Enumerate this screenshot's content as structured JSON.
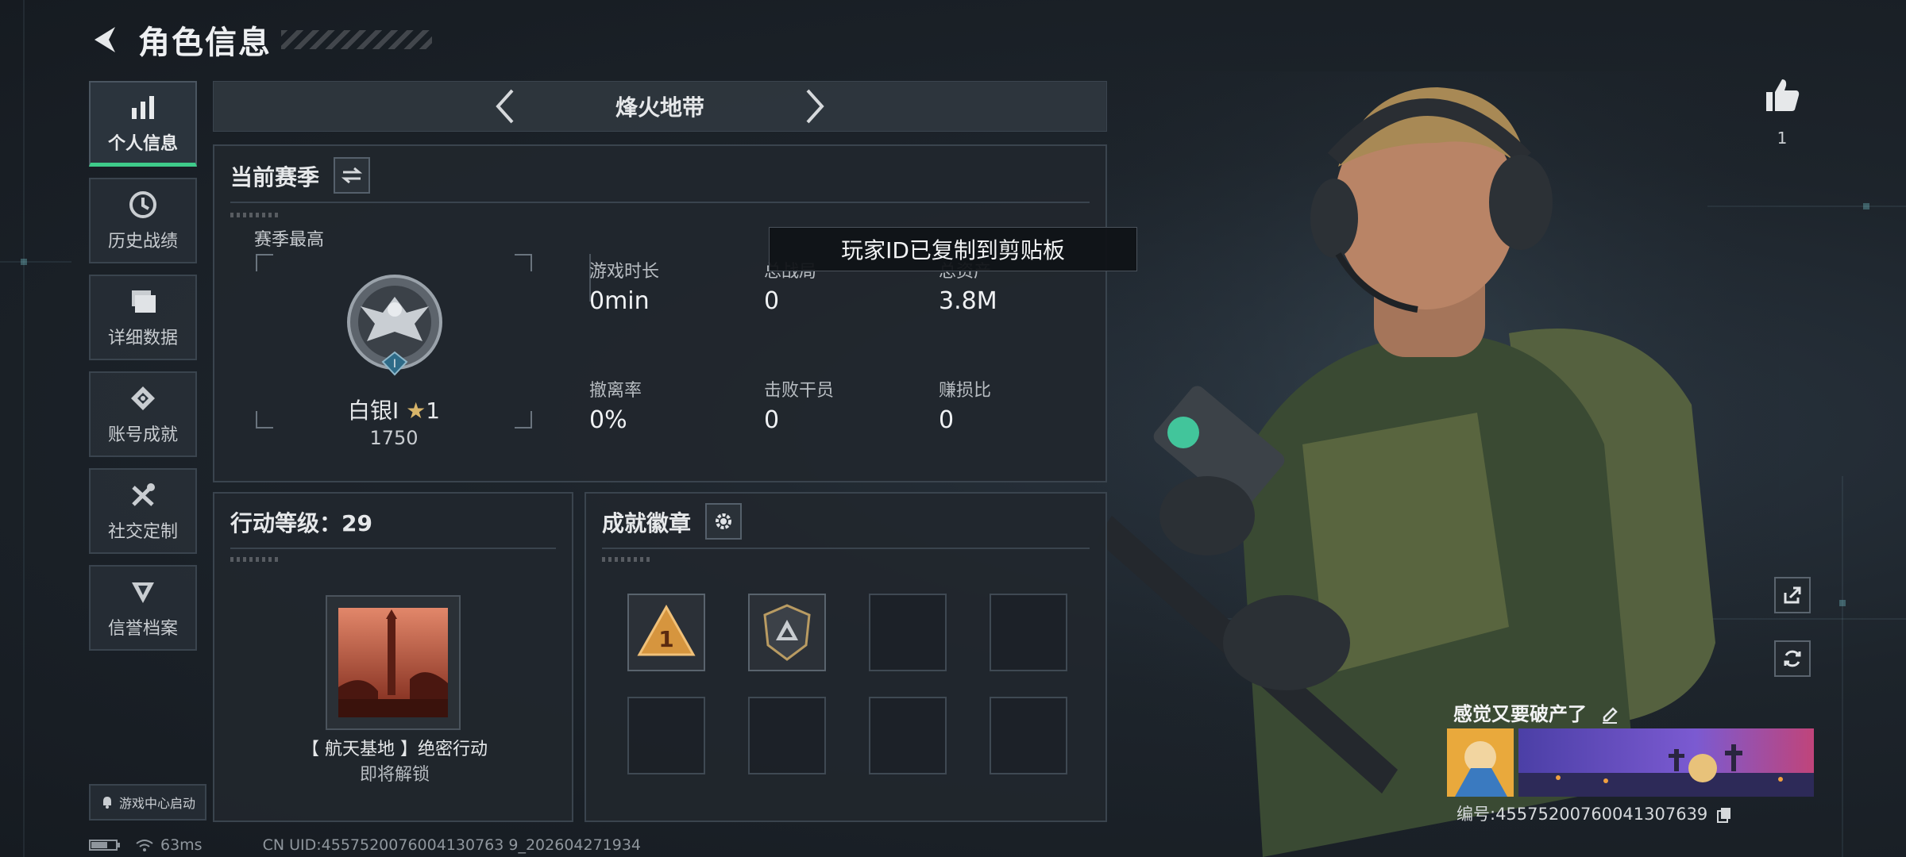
{
  "header": {
    "title": "角色信息"
  },
  "sidebar": {
    "items": [
      {
        "label": "个人信息",
        "icon": "bar-chart-icon",
        "active": true
      },
      {
        "label": "历史战绩",
        "icon": "clock-icon"
      },
      {
        "label": "详细数据",
        "icon": "folder-icon"
      },
      {
        "label": "账号成就",
        "icon": "achievement-icon"
      },
      {
        "label": "社交定制",
        "icon": "tools-icon"
      },
      {
        "label": "信誉档案",
        "icon": "shield-icon"
      }
    ],
    "launch_label": "游戏中心启动"
  },
  "mode": {
    "name": "烽火地带"
  },
  "season": {
    "title": "当前赛季",
    "best_label": "赛季最高",
    "rank_name": "白银I",
    "rank_stars": "1",
    "rank_score": "1750",
    "rank_tier_numeral": "I",
    "stats": [
      {
        "label": "游戏时长",
        "value": "0min"
      },
      {
        "label": "总战局",
        "value": "0"
      },
      {
        "label": "总资产",
        "value": "3.8M"
      },
      {
        "label": "撤离率",
        "value": "0%"
      },
      {
        "label": "击败干员",
        "value": "0"
      },
      {
        "label": "赚损比",
        "value": "0"
      }
    ]
  },
  "toast": {
    "text": "玩家ID已复制到剪贴板"
  },
  "operation": {
    "title": "行动等级：29",
    "mission_name": "【 航天基地 】绝密行动",
    "mission_status": "即将解锁"
  },
  "achievements": {
    "title": "成就徽章",
    "badge1_numeral": "1"
  },
  "profile": {
    "likes": "1",
    "signature": "感觉又要破产了",
    "player_id": "编号:455752007600413076​39"
  },
  "status": {
    "ping": "63ms",
    "uid": "CN UID:4557520076004130763 9_202604271934"
  },
  "colors": {
    "accent": "#3ecb8a",
    "background": "#1c2229",
    "panel_border": "#3a444e"
  }
}
